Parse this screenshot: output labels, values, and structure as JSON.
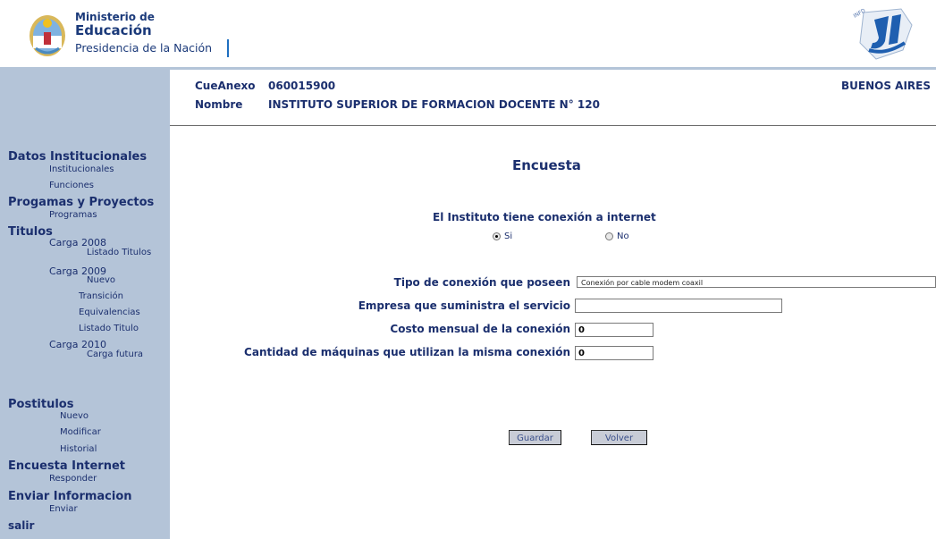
{
  "header": {
    "logo_line1": "Ministerio de",
    "logo_line2": "Educación",
    "logo_line3": "Presidencia de la Nación"
  },
  "info": {
    "cue_label": "CueAnexo",
    "cue_value": "060015900",
    "name_label": "Nombre",
    "name_value": "INSTITUTO SUPERIOR DE FORMACION DOCENTE N° 120",
    "province": "BUENOS AIRES"
  },
  "sidebar": {
    "datos": "Datos Institucionales",
    "institucionales": "Institucionales",
    "funciones": "Funciones",
    "programas_title": "Progamas y Proyectos",
    "programas": "Programas",
    "titulos": "Titulos",
    "carga2008": "Carga 2008",
    "listado_titulos": "Listado Titulos",
    "carga2009": "Carga 2009",
    "nuevo": "Nuevo",
    "transicion": "Transición",
    "equivalencias": "Equivalencias",
    "listado_titulo": "Listado Titulo",
    "carga2010": "Carga 2010",
    "carga_futura": "Carga futura",
    "postitulos": "Postitulos",
    "p_nuevo": "Nuevo",
    "p_modificar": "Modificar",
    "p_historial": "Historial",
    "encuesta": "Encuesta Internet",
    "responder": "Responder",
    "enviar_info": "Enviar Informacion",
    "enviar": "Enviar",
    "salir": "salir"
  },
  "form": {
    "title": "Encuesta",
    "question": "El Instituto tiene conexión a internet",
    "opt_si": "Si",
    "opt_no": "No",
    "selected": "Si",
    "tipo_label": "Tipo de conexión que poseen",
    "tipo_value": "Conexión por cable modem coaxil",
    "empresa_label": "Empresa que suministra el servicio",
    "empresa_value": "",
    "costo_label": "Costo mensual de la conexión",
    "costo_value": "0",
    "maquinas_label": "Cantidad de máquinas que utilizan la misma conexión",
    "maquinas_value": "0",
    "save": "Guardar",
    "back": "Volver"
  },
  "colors": {
    "sidebar_bg": "#b4c4d8",
    "text_navy": "#1b2f6e"
  }
}
